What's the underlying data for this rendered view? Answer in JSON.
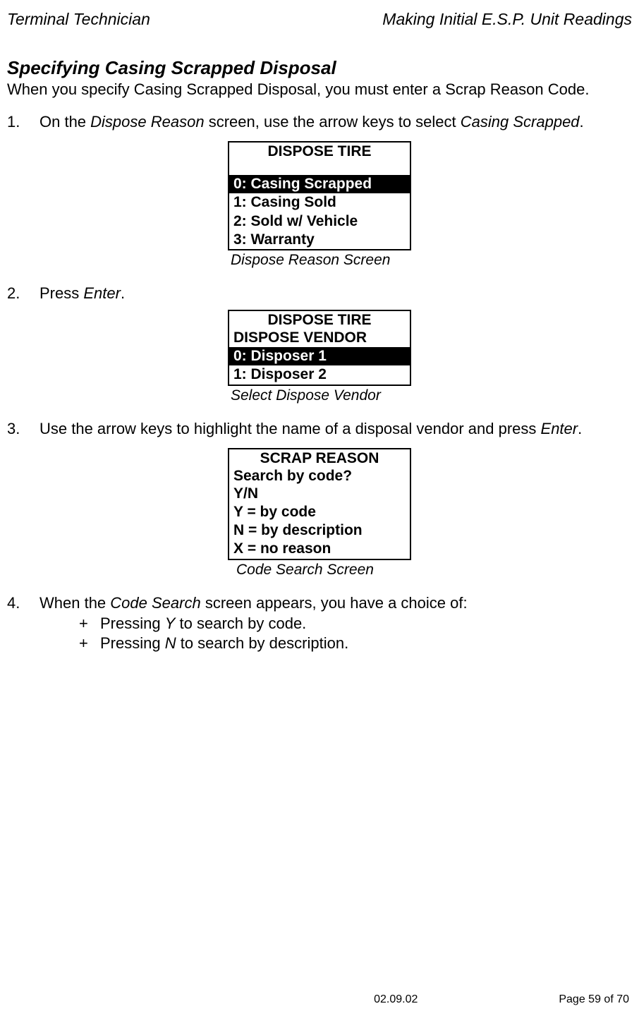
{
  "header": {
    "left": "Terminal Technician",
    "right": "Making Initial E.S.P. Unit Readings"
  },
  "section_title": "Specifying Casing Scrapped Disposal",
  "intro": "When you specify Casing Scrapped Disposal, you must enter a Scrap Reason Code.",
  "steps": {
    "s1": {
      "num": "1.",
      "pre": "On the ",
      "italic1": "Dispose Reason",
      "mid": " screen, use the arrow keys to select ",
      "italic2": "Casing Scrapped",
      "post": "."
    },
    "s2": {
      "num": "2.",
      "pre": "Press ",
      "italic1": "Enter",
      "post": "."
    },
    "s3": {
      "num": "3.",
      "pre": "Use the arrow keys to highlight the name of a disposal vendor and press ",
      "italic1": "Enter",
      "post": "."
    },
    "s4": {
      "num": "4.",
      "pre": "When the ",
      "italic1": "Code Search",
      "mid": " screen appears, you have a choice of:",
      "sub1_bullet": "+",
      "sub1_pre": "Pressing ",
      "sub1_italic": "Y",
      "sub1_post": " to search by code.",
      "sub2_bullet": "+",
      "sub2_pre": "Pressing ",
      "sub2_italic": "N",
      "sub2_post": " to search by description."
    }
  },
  "screens": {
    "dispose_reason": {
      "title": "DISPOSE TIRE",
      "rows": {
        "r0": "0: Casing Scrapped",
        "r1": "1: Casing Sold",
        "r2": "2: Sold w/ Vehicle",
        "r3": "3: Warranty"
      },
      "caption": "Dispose Reason Screen"
    },
    "dispose_vendor": {
      "title": "DISPOSE TIRE",
      "subhead": "DISPOSE VENDOR",
      "rows": {
        "r0": "0: Disposer 1",
        "r1": "1: Disposer 2"
      },
      "caption": "Select Dispose Vendor"
    },
    "code_search": {
      "title": "SCRAP REASON",
      "rows": {
        "r0": "Search by code?",
        "r1": "Y/N",
        "r2": "Y = by code",
        "r3": "N = by description",
        "r4": "X = no reason"
      },
      "caption": "Code Search Screen"
    }
  },
  "footer": {
    "date": "02.09.02",
    "page": "Page 59 of 70"
  }
}
